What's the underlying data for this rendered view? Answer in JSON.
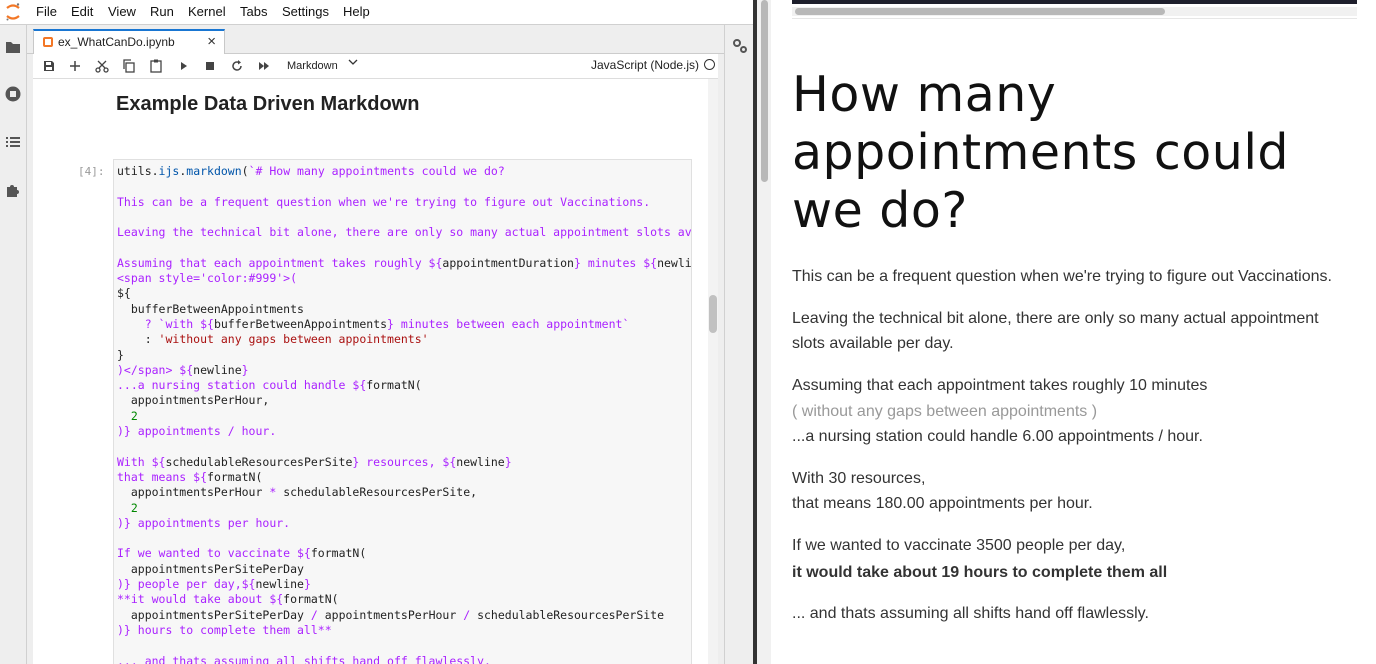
{
  "menubar": {
    "items": [
      "File",
      "Edit",
      "View",
      "Run",
      "Kernel",
      "Tabs",
      "Settings",
      "Help"
    ]
  },
  "leftbar": {
    "icons": [
      "folder-icon",
      "stop-circle-icon",
      "list-icon",
      "puzzle-icon"
    ]
  },
  "tab": {
    "label": "ex_WhatCanDo.ipynb",
    "close": "×"
  },
  "toolbar": {
    "cell_type": "Markdown",
    "kernel": "JavaScript (Node.js)"
  },
  "notebook": {
    "heading": "Example Data Driven Markdown",
    "prompt": "[4]:"
  },
  "preview": {
    "title_lines": [
      "How many",
      "appointments could",
      "we do?"
    ],
    "lines": [
      "This can be a frequent question when we're trying to figure out Vaccinations.",
      "Leaving the technical bit alone, there are only so many actual appointment",
      "slots available per day.",
      "Assuming that each appointment takes roughly 10 minutes",
      "( without any gaps between appointments )",
      "...a nursing station could handle 6.00 appointments / hour.",
      "With 30 resources,",
      "that means 180.00 appointments per hour.",
      "If we wanted to vaccinate 3500 people per day,",
      "it would take about 19 hours to complete them all",
      "... and thats assuming all shifts hand off flawlessly."
    ]
  },
  "colors": {
    "accent": "#1976d2",
    "jupyter_orange": "#f37726",
    "code_keyword": "#aa22ff",
    "code_string": "#aa1111",
    "code_number": "#008800"
  }
}
